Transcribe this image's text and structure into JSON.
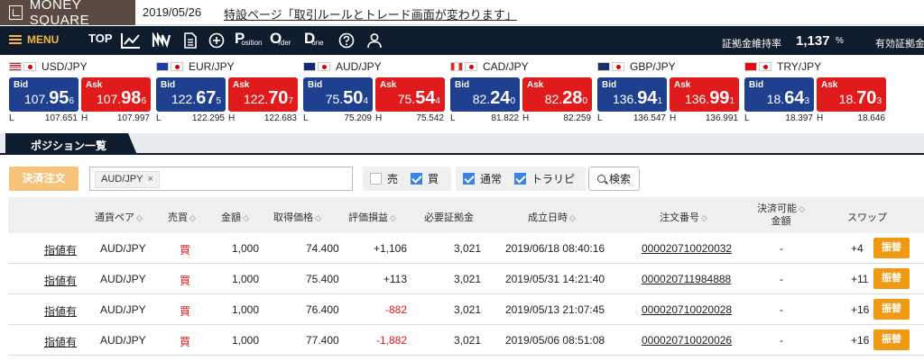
{
  "brand": {
    "logo_text": "MONEY SQUARE"
  },
  "news": {
    "date": "2019/05/26",
    "text": "特設ページ「取引ルールとトレード画面が変わります」"
  },
  "nav": {
    "menu_label": "MENU",
    "top_label": "TOP",
    "position_big": "P",
    "position_small": "osition",
    "order_big": "O",
    "order_small": "rder",
    "done_big": "D",
    "done_small": "one",
    "margin_ratio_label": "証拠金維持率",
    "margin_ratio_value": "1,137",
    "margin_ratio_unit": "%",
    "effective_margin_label": "有効証拠金"
  },
  "rates": [
    {
      "pair": "USD/JPY",
      "flag": "us",
      "bid": [
        "107.",
        "95",
        "6"
      ],
      "ask": [
        "107.",
        "98",
        "6"
      ],
      "low": "107.651",
      "high": "107.997"
    },
    {
      "pair": "EUR/JPY",
      "flag": "eu",
      "bid": [
        "122.",
        "67",
        "5"
      ],
      "ask": [
        "122.",
        "70",
        "7"
      ],
      "low": "122.295",
      "high": "122.683"
    },
    {
      "pair": "AUD/JPY",
      "flag": "au",
      "bid": [
        "75.",
        "50",
        "4"
      ],
      "ask": [
        "75.",
        "54",
        "4"
      ],
      "low": "75.209",
      "high": "75.542"
    },
    {
      "pair": "CAD/JPY",
      "flag": "ca",
      "bid": [
        "82.",
        "24",
        "0"
      ],
      "ask": [
        "82.",
        "28",
        "0"
      ],
      "low": "81.822",
      "high": "82.259"
    },
    {
      "pair": "GBP/JPY",
      "flag": "gb",
      "bid": [
        "136.",
        "94",
        "1"
      ],
      "ask": [
        "136.",
        "99",
        "1"
      ],
      "low": "136.547",
      "high": "136.991"
    },
    {
      "pair": "TRY/JPY",
      "flag": "tr",
      "bid": [
        "18.",
        "64",
        "3"
      ],
      "ask": [
        "18.",
        "70",
        "3"
      ],
      "low": "18.397",
      "high": "18.646"
    }
  ],
  "quote_labels": {
    "bid": "Bid",
    "ask": "Ask",
    "low": "L",
    "high": "H"
  },
  "section": {
    "title": "ポジション一覧"
  },
  "filters": {
    "order_button": "決済注文",
    "chip": "AUD/JPY",
    "chip_remove": "×",
    "sell_label": "売",
    "buy_label": "買",
    "normal_label": "通常",
    "trap_label": "トラリピ",
    "search_label": "検索"
  },
  "table": {
    "headers": {
      "pair": "通貨ペア",
      "side": "売買",
      "amount": "金額",
      "price": "取得価格",
      "pl": "評価損益",
      "margin": "必要証拠金",
      "time": "成立日時",
      "order_no": "注文番号",
      "settle_1": "決済可能",
      "settle_2": "金額",
      "swap": "スワップ"
    },
    "rows": [
      {
        "link": "指値有",
        "pair": "AUD/JPY",
        "side": "買",
        "amount": "1,000",
        "price": "74.400",
        "pl": "+1,106",
        "margin": "3,021",
        "time": "2019/06/18 08:40:16",
        "order_no": "000020710020032",
        "settle": "-",
        "swap": "+4",
        "swap_btn": "振替"
      },
      {
        "link": "指値有",
        "pair": "AUD/JPY",
        "side": "買",
        "amount": "1,000",
        "price": "75.400",
        "pl": "+113",
        "margin": "3,021",
        "time": "2019/05/31 14:21:40",
        "order_no": "000020711984888",
        "settle": "-",
        "swap": "+11",
        "swap_btn": "振替"
      },
      {
        "link": "指値有",
        "pair": "AUD/JPY",
        "side": "買",
        "amount": "1,000",
        "price": "76.400",
        "pl": "-882",
        "margin": "3,021",
        "time": "2019/05/13 21:07:45",
        "order_no": "000020710020028",
        "settle": "-",
        "swap": "+16",
        "swap_btn": "振替"
      },
      {
        "link": "指値有",
        "pair": "AUD/JPY",
        "side": "買",
        "amount": "1,000",
        "price": "77.400",
        "pl": "-1,882",
        "margin": "3,021",
        "time": "2019/05/06 08:51:08",
        "order_no": "000020710020026",
        "settle": "-",
        "swap": "+16",
        "swap_btn": "振替"
      }
    ]
  },
  "colors": {
    "navbar": "#0f1c2e",
    "bid": "#1f3f8f",
    "ask": "#e11b1b",
    "accent": "#f09a13",
    "menu": "#f3b840"
  }
}
